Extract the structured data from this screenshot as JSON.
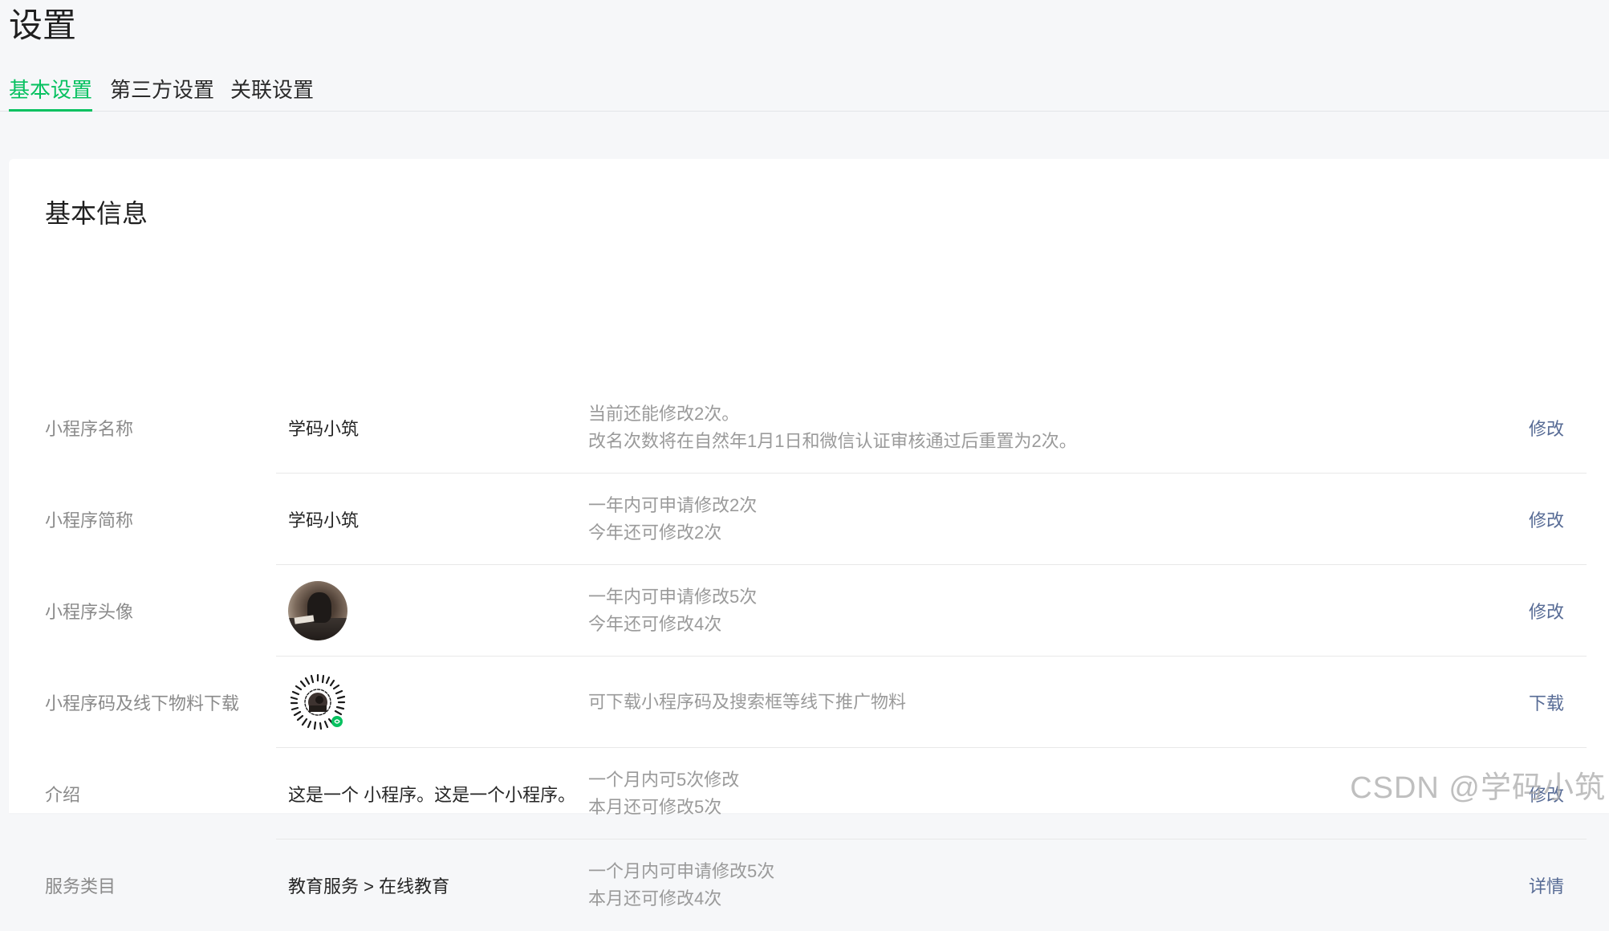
{
  "page": {
    "title": "设置"
  },
  "tabs": [
    {
      "label": "基本设置",
      "active": true
    },
    {
      "label": "第三方设置",
      "active": false
    },
    {
      "label": "关联设置",
      "active": false
    }
  ],
  "section": {
    "title": "基本信息"
  },
  "rows": [
    {
      "label": "小程序名称",
      "value": "学码小筑",
      "desc": [
        "当前还能修改2次。",
        "改名次数将在自然年1月1日和微信认证审核通过后重置为2次。"
      ],
      "action": "修改"
    },
    {
      "label": "小程序简称",
      "value": "学码小筑",
      "desc": [
        "一年内可申请修改2次",
        "今年还可修改2次"
      ],
      "action": "修改"
    },
    {
      "label": "小程序头像",
      "value": "",
      "desc": [
        "一年内可申请修改5次",
        "今年还可修改4次"
      ],
      "action": "修改"
    },
    {
      "label": "小程序码及线下物料下载",
      "value": "",
      "desc": [
        "可下载小程序码及搜索框等线下推广物料"
      ],
      "action": "下载"
    },
    {
      "label": "介绍",
      "value": "这是一个 小程序。这是一个小程序。",
      "desc": [
        "一个月内可5次修改",
        "本月还可修改5次"
      ],
      "action": "修改"
    },
    {
      "label": "服务类目",
      "value": "教育服务 > 在线教育",
      "desc": [
        "一个月内可申请修改5次",
        "本月还可修改4次"
      ],
      "action": "详情"
    }
  ],
  "watermark": "CSDN @学码小筑",
  "colors": {
    "accent": "#07c160",
    "link": "#576b95",
    "label": "#8a8a8a",
    "desc": "#9a9a9a",
    "background": "#f6f7f9"
  }
}
